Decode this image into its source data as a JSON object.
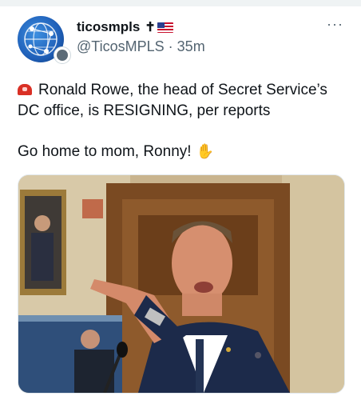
{
  "author": {
    "display_name": "ticosmpls",
    "handle": "@TicosMPLS",
    "time_sep": "·",
    "time": "35m",
    "avatar_icon": "globe-network-icon",
    "badge_icon": "affiliate-badge-icon"
  },
  "more_label": "···",
  "tweet": {
    "line1": "Ronald Rowe, the head of Secret Service’s DC office, is RESIGNING, per reports",
    "line2": "Go home to mom, Ronny!",
    "emoji_start": "police-siren-icon",
    "emoji_end": "waving-hand-icon"
  },
  "media": {
    "description_icon": "photo-man-pointing-at-hearing"
  },
  "colors": {
    "text": "#0f1419",
    "muted": "#536471",
    "background": "#ffffff"
  }
}
